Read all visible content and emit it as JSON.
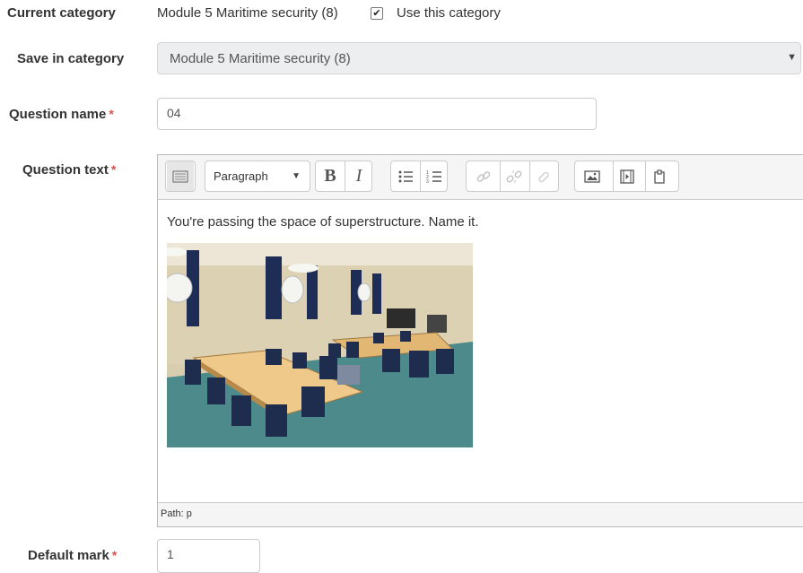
{
  "form": {
    "current_category": {
      "label": "Current category",
      "value": "Module 5 Maritime security (8)",
      "checkbox_checked": true,
      "checkbox_label": "Use this category"
    },
    "save_in_category": {
      "label": "Save in category",
      "selected": "Module 5 Maritime security (8)"
    },
    "question_name": {
      "label": "Question name",
      "required_mark": "*",
      "value": "04"
    },
    "question_text": {
      "label": "Question text",
      "required_mark": "*",
      "toolbar": {
        "paragraph_select": "Paragraph",
        "bold": "B",
        "italic": "I"
      },
      "content": "You're passing the space of superstructure. Name it.",
      "path": "Path: p"
    },
    "default_mark": {
      "label": "Default mark",
      "required_mark": "*",
      "value": "1"
    }
  }
}
